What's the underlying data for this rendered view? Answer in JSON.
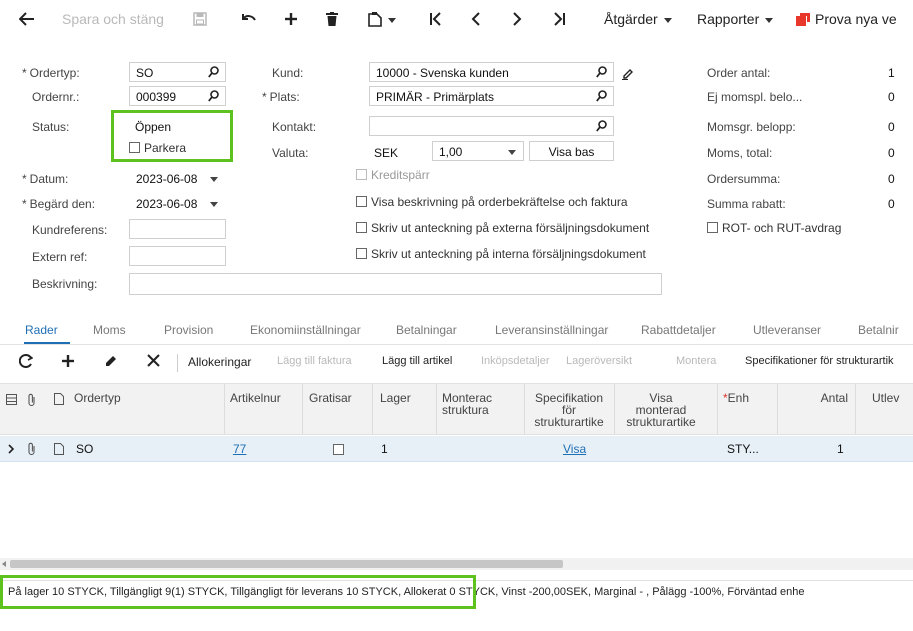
{
  "toolbar": {
    "save_close": "Spara och stäng",
    "actions": "Åtgärder",
    "reports": "Rapporter",
    "try_new": "Prova nya ve",
    "brand_color": "#e8382b"
  },
  "form": {
    "ordertyp_label": "Ordertyp:",
    "ordertyp_value": "SO",
    "ordernr_label": "Ordernr.:",
    "ordernr_value": "000399",
    "status_label": "Status:",
    "status_value": "Öppen",
    "parkera_label": "Parkera",
    "datum_label": "Datum:",
    "datum_value": "2023-06-08",
    "begard_label": "Begärd den:",
    "begard_value": "2023-06-08",
    "kundref_label": "Kundreferens:",
    "extref_label": "Extern ref:",
    "beskrivning_label": "Beskrivning:",
    "kund_label": "Kund:",
    "kund_value": "10000 - Svenska kunden",
    "plats_label": "Plats:",
    "plats_value": "PRIMÄR - Primärplats",
    "kontakt_label": "Kontakt:",
    "valuta_label": "Valuta:",
    "valuta_value": "SEK",
    "rate_value": "1,00",
    "visa_bas": "Visa bas",
    "kreditsparr": "Kreditspärr",
    "visa_beskrivning": "Visa beskrivning på orderbekräftelse och faktura",
    "skriv_externa": "Skriv ut anteckning på externa försäljningsdokument",
    "skriv_interna": "Skriv ut anteckning på interna försäljningsdokument",
    "order_antal_label": "Order antal:",
    "order_antal_value": "1",
    "ej_momspl_label": "Ej momspl. belo...",
    "ej_momspl_value": "0",
    "momsgr_label": "Momsgr. belopp:",
    "momsgr_value": "0",
    "moms_total_label": "Moms, total:",
    "moms_total_value": "0",
    "ordersumma_label": "Ordersumma:",
    "ordersumma_value": "0",
    "summa_rabatt_label": "Summa rabatt:",
    "summa_rabatt_value": "0",
    "rot_rut": "ROT- och RUT-avdrag"
  },
  "tabs": [
    "Rader",
    "Moms",
    "Provision",
    "Ekonomiinställningar",
    "Betalningar",
    "Leveransinställningar",
    "Rabattdetaljer",
    "Utleveranser",
    "Betalnir"
  ],
  "grid_toolbar": {
    "allokeringar": "Allokeringar",
    "lagg_till_faktura": "Lägg till faktura",
    "lagg_till_artikel": "Lägg till artikel",
    "inkopsdetaljer": "Inköpsdetaljer",
    "lageroversikt": "Lageröversikt",
    "montera": "Montera",
    "specifikationer": "Specifikationer för strukturartik"
  },
  "grid": {
    "headers": {
      "ordertyp": "Ordertyp",
      "artikelnr": "Artikelnur",
      "gratisar": "Gratisar",
      "lager": "Lager",
      "monterad_1": "Monterac",
      "monterad_2": "struktura",
      "spec_1": "Specifikation",
      "spec_2": "för",
      "spec_3": "strukturartike",
      "visa_1": "Visa",
      "visa_2": "monterad",
      "visa_3": "strukturartike",
      "enh": "Enh",
      "antal": "Antal",
      "utlev": "Utlev"
    },
    "row": {
      "ordertyp": "SO",
      "artikel": "77",
      "lager": "1",
      "spec": "Visa",
      "enh": "STY...",
      "antal": "1"
    }
  },
  "status_bar": "På lager 10 STYCK, Tillgängligt 9(1) STYCK, Tillgängligt för leverans 10 STYCK, Allokerat 0 STYCK, Vinst -200,00SEK, Marginal - , Pålägg -100%, Förväntad enhe",
  "highlight_color": "#5dc21e",
  "link_color": "#1f6fb5"
}
